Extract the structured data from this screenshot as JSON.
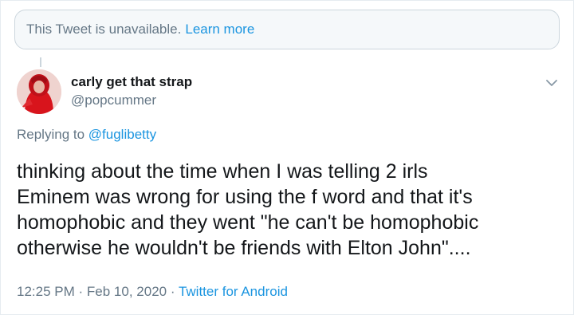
{
  "unavailable_notice": {
    "text": "This Tweet is unavailable.",
    "link": "Learn more"
  },
  "user": {
    "display_name": "carly get that strap",
    "handle": "@popcummer"
  },
  "icons": {
    "menu": "chevron-down-icon"
  },
  "reply": {
    "prefix": "Replying to",
    "mention": "@fuglibetty"
  },
  "tweet": {
    "lines": [
      "thinking about the time when I was telling 2 irls",
      "Eminem was wrong for using the f word and that it's",
      "homophobic and they went \"he can't be homophobic",
      "otherwise he wouldn't be friends with Elton John\"...."
    ]
  },
  "meta": {
    "time": "12:25 PM",
    "separator": "·",
    "date": "Feb 10, 2020",
    "source": "Twitter for Android"
  },
  "colors": {
    "link": "#1b95e0",
    "secondary_text": "#657786",
    "primary_text": "#14171a"
  }
}
